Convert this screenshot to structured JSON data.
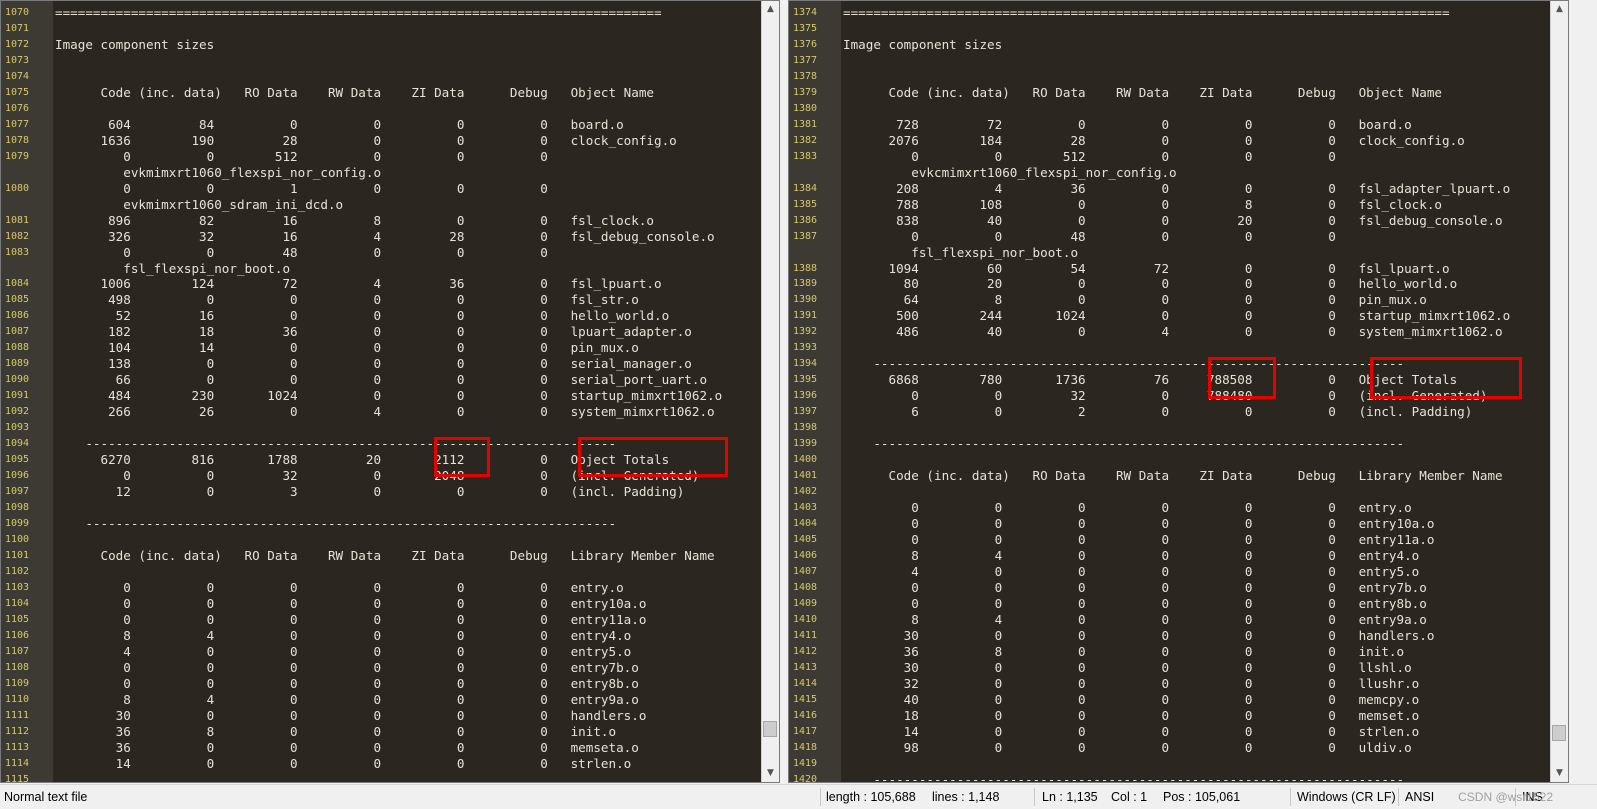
{
  "left": {
    "rows": [
      {
        "num": "1070",
        "text": "================================================================================"
      },
      {
        "num": "1071",
        "text": ""
      },
      {
        "num": "1072",
        "text": "Image component sizes"
      },
      {
        "num": "1073",
        "text": ""
      },
      {
        "num": "1074",
        "text": ""
      },
      {
        "num": "1075",
        "text": "      Code (inc. data)   RO Data    RW Data    ZI Data      Debug   Object Name"
      },
      {
        "num": "1076",
        "text": ""
      },
      {
        "num": "1077",
        "text": "       604         84          0          0          0          0   board.o"
      },
      {
        "num": "1078",
        "text": "      1636        190         28          0          0          0   clock_config.o"
      },
      {
        "num": "1079",
        "text": "         0          0        512          0          0          0"
      },
      {
        "num": "",
        "text": "         evkmimxrt1060_flexspi_nor_config.o"
      },
      {
        "num": "1080",
        "text": "         0          0          1          0          0          0"
      },
      {
        "num": "",
        "text": "         evkmimxrt1060_sdram_ini_dcd.o"
      },
      {
        "num": "1081",
        "text": "       896         82         16          8          0          0   fsl_clock.o"
      },
      {
        "num": "1082",
        "text": "       326         32         16          4         28          0   fsl_debug_console.o"
      },
      {
        "num": "1083",
        "text": "         0          0         48          0          0          0"
      },
      {
        "num": "",
        "text": "         fsl_flexspi_nor_boot.o"
      },
      {
        "num": "1084",
        "text": "      1006        124         72          4         36          0   fsl_lpuart.o"
      },
      {
        "num": "1085",
        "text": "       498          0          0          0          0          0   fsl_str.o"
      },
      {
        "num": "1086",
        "text": "        52         16          0          0          0          0   hello_world.o"
      },
      {
        "num": "1087",
        "text": "       182         18         36          0          0          0   lpuart_adapter.o"
      },
      {
        "num": "1088",
        "text": "       104         14          0          0          0          0   pin_mux.o"
      },
      {
        "num": "1089",
        "text": "       138          0          0          0          0          0   serial_manager.o"
      },
      {
        "num": "1090",
        "text": "        66          0          0          0          0          0   serial_port_uart.o"
      },
      {
        "num": "1091",
        "text": "       484        230       1024          0          0          0   startup_mimxrt1062.o"
      },
      {
        "num": "1092",
        "text": "       266         26          0          4          0          0   system_mimxrt1062.o"
      },
      {
        "num": "1093",
        "text": ""
      },
      {
        "num": "1094",
        "text": "    ----------------------------------------------------------------------"
      },
      {
        "num": "1095",
        "text": "      6270        816       1788         20       2112          0   Object Totals"
      },
      {
        "num": "1096",
        "text": "         0          0         32          0       2048          0   (incl. Generated)"
      },
      {
        "num": "1097",
        "text": "        12          0          3          0          0          0   (incl. Padding)"
      },
      {
        "num": "1098",
        "text": ""
      },
      {
        "num": "1099",
        "text": "    ----------------------------------------------------------------------"
      },
      {
        "num": "1100",
        "text": ""
      },
      {
        "num": "1101",
        "text": "      Code (inc. data)   RO Data    RW Data    ZI Data      Debug   Library Member Name"
      },
      {
        "num": "1102",
        "text": ""
      },
      {
        "num": "1103",
        "text": "         0          0          0          0          0          0   entry.o"
      },
      {
        "num": "1104",
        "text": "         0          0          0          0          0          0   entry10a.o"
      },
      {
        "num": "1105",
        "text": "         0          0          0          0          0          0   entry11a.o"
      },
      {
        "num": "1106",
        "text": "         8          4          0          0          0          0   entry4.o"
      },
      {
        "num": "1107",
        "text": "         4          0          0          0          0          0   entry5.o"
      },
      {
        "num": "1108",
        "text": "         0          0          0          0          0          0   entry7b.o"
      },
      {
        "num": "1109",
        "text": "         0          0          0          0          0          0   entry8b.o"
      },
      {
        "num": "1110",
        "text": "         8          4          0          0          0          0   entry9a.o"
      },
      {
        "num": "1111",
        "text": "        30          0          0          0          0          0   handlers.o"
      },
      {
        "num": "1112",
        "text": "        36          8          0          0          0          0   init.o"
      },
      {
        "num": "1113",
        "text": "        36          0          0          0          0          0   memseta.o"
      },
      {
        "num": "1114",
        "text": "        14          0          0          0          0          0   strlen.o"
      },
      {
        "num": "1115",
        "text": ""
      }
    ]
  },
  "right": {
    "rows": [
      {
        "num": "1374",
        "text": "================================================================================"
      },
      {
        "num": "1375",
        "text": ""
      },
      {
        "num": "1376",
        "text": "Image component sizes"
      },
      {
        "num": "1377",
        "text": ""
      },
      {
        "num": "1378",
        "text": ""
      },
      {
        "num": "1379",
        "text": "      Code (inc. data)   RO Data    RW Data    ZI Data      Debug   Object Name"
      },
      {
        "num": "1380",
        "text": ""
      },
      {
        "num": "1381",
        "text": "       728         72          0          0          0          0   board.o"
      },
      {
        "num": "1382",
        "text": "      2076        184         28          0          0          0   clock_config.o"
      },
      {
        "num": "1383",
        "text": "         0          0        512          0          0          0"
      },
      {
        "num": "",
        "text": "         evkcmimxrt1060_flexspi_nor_config.o"
      },
      {
        "num": "1384",
        "text": "       208          4         36          0          0          0   fsl_adapter_lpuart.o"
      },
      {
        "num": "1385",
        "text": "       788        108          0          0          8          0   fsl_clock.o"
      },
      {
        "num": "1386",
        "text": "       838         40          0          0         20          0   fsl_debug_console.o"
      },
      {
        "num": "1387",
        "text": "         0          0         48          0          0          0"
      },
      {
        "num": "",
        "text": "         fsl_flexspi_nor_boot.o"
      },
      {
        "num": "1388",
        "text": "      1094         60         54         72          0          0   fsl_lpuart.o"
      },
      {
        "num": "1389",
        "text": "        80         20          0          0          0          0   hello_world.o"
      },
      {
        "num": "1390",
        "text": "        64          8          0          0          0          0   pin_mux.o"
      },
      {
        "num": "1391",
        "text": "       500        244       1024          0          0          0   startup_mimxrt1062.o"
      },
      {
        "num": "1392",
        "text": "       486         40          0          4          0          0   system_mimxrt1062.o"
      },
      {
        "num": "1393",
        "text": ""
      },
      {
        "num": "1394",
        "text": "    ----------------------------------------------------------------------"
      },
      {
        "num": "1395",
        "text": "      6868        780       1736         76     788508          0   Object Totals"
      },
      {
        "num": "1396",
        "text": "         0          0         32          0     788480          0   (incl. Generated)"
      },
      {
        "num": "1397",
        "text": "         6          0          2          0          0          0   (incl. Padding)"
      },
      {
        "num": "1398",
        "text": ""
      },
      {
        "num": "1399",
        "text": "    ----------------------------------------------------------------------"
      },
      {
        "num": "1400",
        "text": ""
      },
      {
        "num": "1401",
        "text": "      Code (inc. data)   RO Data    RW Data    ZI Data      Debug   Library Member Name"
      },
      {
        "num": "1402",
        "text": ""
      },
      {
        "num": "1403",
        "text": "         0          0          0          0          0          0   entry.o"
      },
      {
        "num": "1404",
        "text": "         0          0          0          0          0          0   entry10a.o"
      },
      {
        "num": "1405",
        "text": "         0          0          0          0          0          0   entry11a.o"
      },
      {
        "num": "1406",
        "text": "         8          4          0          0          0          0   entry4.o"
      },
      {
        "num": "1407",
        "text": "         4          0          0          0          0          0   entry5.o"
      },
      {
        "num": "1408",
        "text": "         0          0          0          0          0          0   entry7b.o"
      },
      {
        "num": "1409",
        "text": "         0          0          0          0          0          0   entry8b.o"
      },
      {
        "num": "1410",
        "text": "         8          4          0          0          0          0   entry9a.o"
      },
      {
        "num": "1411",
        "text": "        30          0          0          0          0          0   handlers.o"
      },
      {
        "num": "1412",
        "text": "        36          8          0          0          0          0   init.o"
      },
      {
        "num": "1413",
        "text": "        30          0          0          0          0          0   llshl.o"
      },
      {
        "num": "1414",
        "text": "        32          0          0          0          0          0   llushr.o"
      },
      {
        "num": "1415",
        "text": "        40          0          0          0          0          0   memcpy.o"
      },
      {
        "num": "1416",
        "text": "        18          0          0          0          0          0   memset.o"
      },
      {
        "num": "1417",
        "text": "        14          0          0          0          0          0   strlen.o"
      },
      {
        "num": "1418",
        "text": "        98          0          0          0          0          0   uldiv.o"
      },
      {
        "num": "1419",
        "text": ""
      },
      {
        "num": "1420",
        "text": "    ----------------------------------------------------------------------"
      }
    ]
  },
  "status": {
    "file_type": "Normal text file",
    "length": "length : 105,688",
    "lines": "lines : 1,148",
    "ln": "Ln : 1,135",
    "col": "Col : 1",
    "pos": "Pos : 105,061",
    "eol": "Windows (CR LF)",
    "encoding": "ANSI",
    "mode": "INS",
    "watermark": "CSDN @wsr1522"
  },
  "scroll": {
    "left_position": 0.97,
    "right_position": 0.97
  },
  "colors": {
    "background": "#2b2720",
    "gutter": "#3c3a32",
    "line_number": "#d8c86e",
    "text": "#e6e2d6",
    "highlight": "#e60000"
  }
}
